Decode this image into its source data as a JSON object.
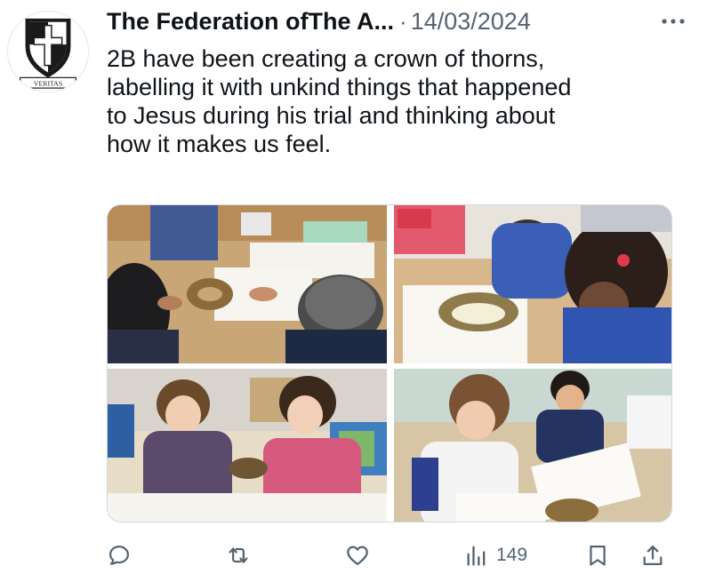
{
  "author": {
    "name": "The Federation ofThe A...",
    "separator": "·",
    "date": "14/03/2024",
    "avatar_motto": "VERITAS"
  },
  "tweet": {
    "lines": [
      "2B have been creating a crown of thorns,",
      "labelling it with unkind things that happened",
      "to Jesus during his trial and thinking about",
      "how it makes us feel."
    ]
  },
  "media": {
    "photos": [
      {
        "description_icon": "photo-children-crown-table"
      },
      {
        "description_icon": "photo-girl-crown-paper"
      },
      {
        "description_icon": "photo-two-girls-crown"
      },
      {
        "description_icon": "photo-children-writing"
      }
    ]
  },
  "actions": {
    "reply_icon": "reply-icon",
    "retweet_icon": "retweet-icon",
    "like_icon": "heart-icon",
    "views_icon": "views-icon",
    "views_count": "149",
    "bookmark_icon": "bookmark-icon",
    "share_icon": "share-icon"
  },
  "colors": {
    "text": "#0f1419",
    "muted": "#536471",
    "border": "#cfd9de"
  }
}
